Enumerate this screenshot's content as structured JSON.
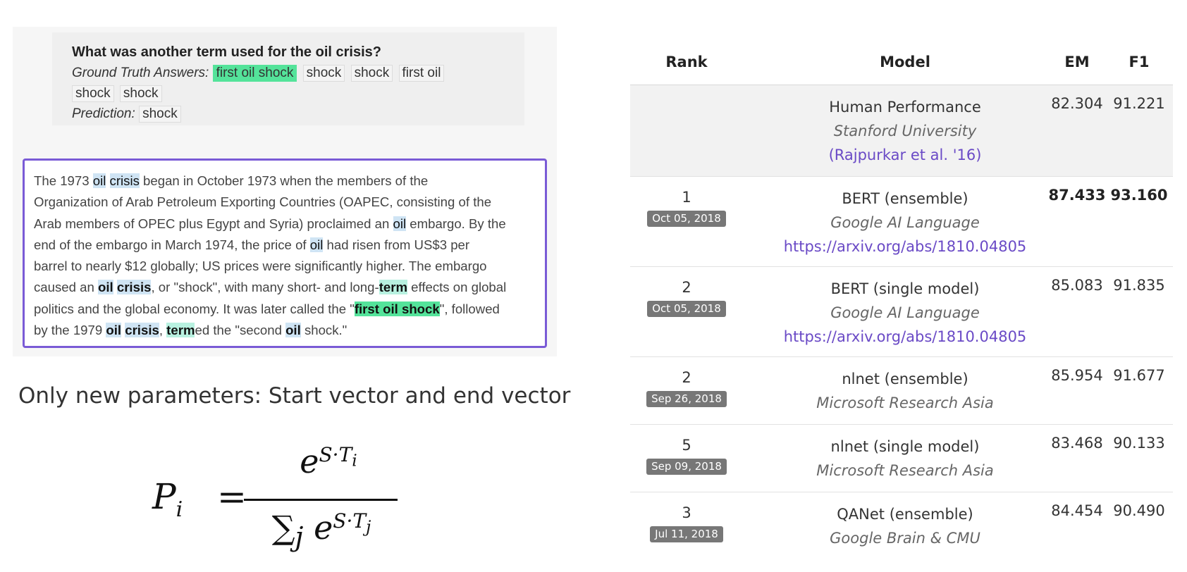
{
  "squad_example": {
    "question": "What was another term used for the oil crisis?",
    "ground_truth_label": "Ground Truth Answers:",
    "ground_truth_answers": [
      "first oil shock",
      "shock",
      "shock",
      "first oil shock",
      "shock"
    ],
    "prediction_label": "Prediction:",
    "prediction": "shock",
    "context": {
      "s1": "The 1973 ",
      "w1": "oil",
      "s2": " ",
      "w2": "crisis",
      "s3": " began in October 1973 when the members of the",
      "line2": "Organization of Arab Petroleum Exporting Countries (OAPEC, consisting of the",
      "line3a": "Arab members of OPEC plus Egypt and Syria) proclaimed an ",
      "w3": "oil",
      "line3b": " embargo. By the",
      "line4a": "end of the embargo in March 1974, the price of ",
      "w4": "oil",
      "line4b": " had risen from US$3 per",
      "line5": "barrel to nearly $12 globally; US prices were significantly higher. The embargo",
      "line6a": "caused an ",
      "w6a": "oil",
      "w6b": "crisis",
      "line6b": ", or \"shock\", with many short- and long-",
      "w6c": "term",
      "line6c": " effects on global",
      "line7a": "politics and the global economy. It was later called the \"",
      "w7": "first oil shock",
      "line7b": "\", followed",
      "line8a": "by the 1979 ",
      "w8a": "oil",
      "w8b": "crisis",
      "line8b": ", ",
      "w8c": "term",
      "line8c": "ed the \"second ",
      "w8d": "oil",
      "line8d": " shock.\""
    }
  },
  "note": "Only new parameters: Start vector and end vector",
  "formula": {
    "lhs": "P",
    "lhs_sub": "i",
    "equals": "=",
    "num_base": "e",
    "num_exp": "S·T",
    "num_exp_sub": "i",
    "den_sum": "∑",
    "den_sum_sub": "j",
    "den_base": "e",
    "den_exp": "S·T",
    "den_exp_sub": "j"
  },
  "leaderboard": {
    "headers": {
      "rank": "Rank",
      "model": "Model",
      "em": "EM",
      "f1": "F1"
    },
    "rows": [
      {
        "rank": "",
        "date": "",
        "model": "Human Performance",
        "org": "Stanford University",
        "link": "(Rajpurkar et al. '16)",
        "em": "82.304",
        "f1": "91.221"
      },
      {
        "rank": "1",
        "date": "Oct 05, 2018",
        "model": "BERT (ensemble)",
        "org": "Google AI Language",
        "link": "https://arxiv.org/abs/1810.04805",
        "em": "87.433",
        "f1": "93.160"
      },
      {
        "rank": "2",
        "date": "Oct 05, 2018",
        "model": "BERT (single model)",
        "org": "Google AI Language",
        "link": "https://arxiv.org/abs/1810.04805",
        "em": "85.083",
        "f1": "91.835"
      },
      {
        "rank": "2",
        "date": "Sep 26, 2018",
        "model": "nlnet (ensemble)",
        "org": "Microsoft Research Asia",
        "link": "",
        "em": "85.954",
        "f1": "91.677"
      },
      {
        "rank": "5",
        "date": "Sep 09, 2018",
        "model": "nlnet (single model)",
        "org": "Microsoft Research Asia",
        "link": "",
        "em": "83.468",
        "f1": "90.133"
      },
      {
        "rank": "3",
        "date": "Jul 11, 2018",
        "model": "QANet (ensemble)",
        "org": "Google Brain & CMU",
        "link": "",
        "em": "84.454",
        "f1": "90.490"
      }
    ]
  }
}
